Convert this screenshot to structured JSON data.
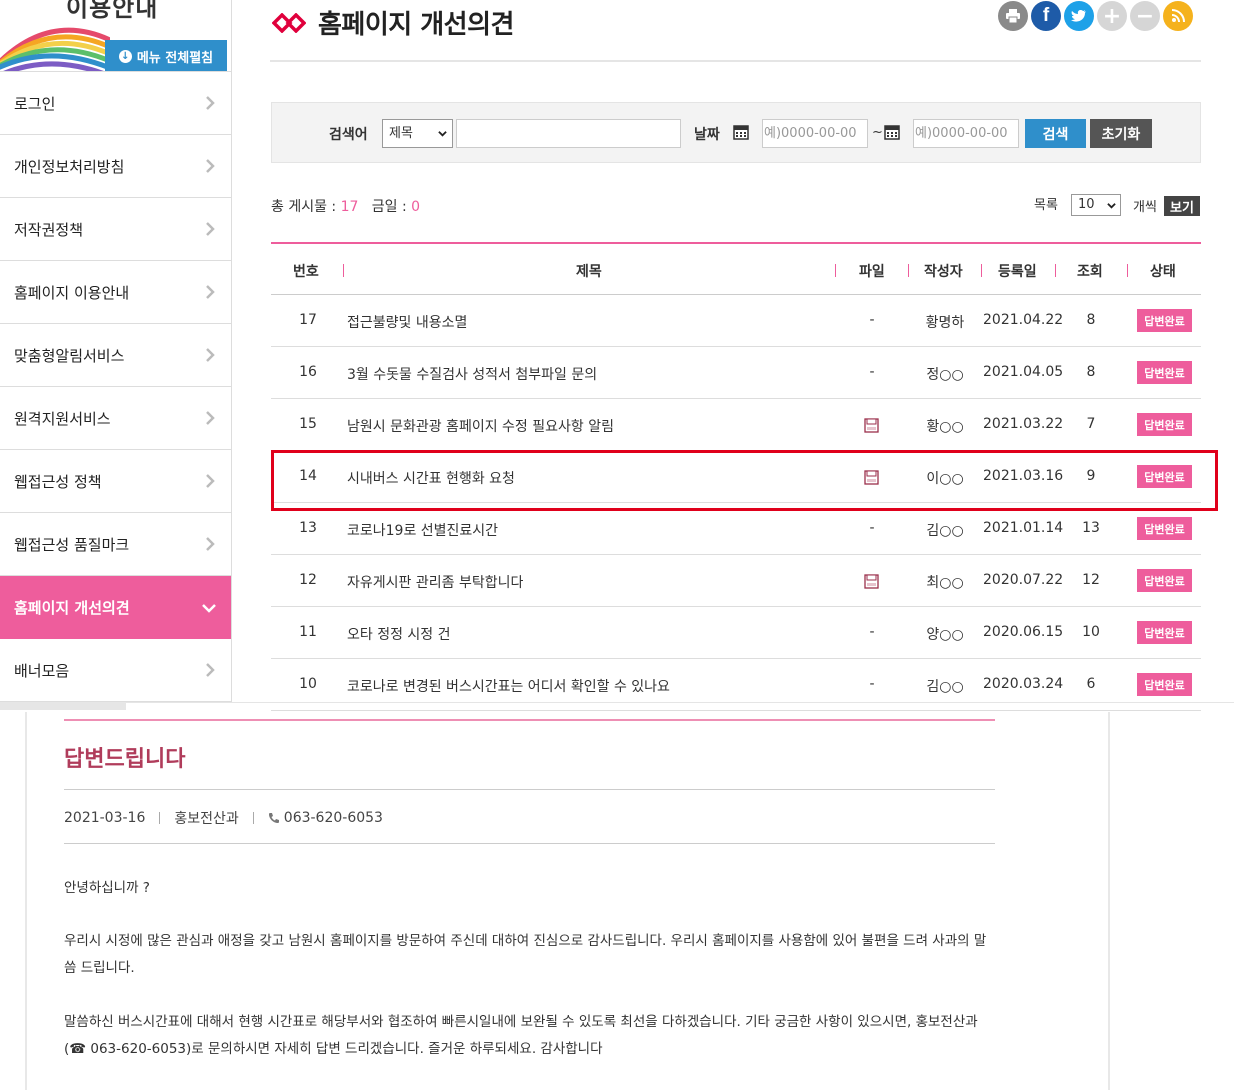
{
  "sidebar": {
    "title": "이용안내",
    "toggle_label": "메뉴 전체펼침",
    "items": [
      {
        "label": "로그인",
        "active": false
      },
      {
        "label": "개인정보처리방침",
        "active": false
      },
      {
        "label": "저작권정책",
        "active": false
      },
      {
        "label": "홈페이지 이용안내",
        "active": false
      },
      {
        "label": "맞춤형알림서비스",
        "active": false
      },
      {
        "label": "원격지원서비스",
        "active": false
      },
      {
        "label": "웹접근성 정책",
        "active": false
      },
      {
        "label": "웹접근성 품질마크",
        "active": false
      },
      {
        "label": "홈페이지 개선의견",
        "active": true
      },
      {
        "label": "배너모음",
        "active": false
      }
    ]
  },
  "header": {
    "title": "홈페이지 개선의견",
    "share_icons": [
      "print-icon",
      "facebook-icon",
      "twitter-icon",
      "zoom-in-icon",
      "zoom-out-icon",
      "rss-icon"
    ]
  },
  "search": {
    "label": "검색어",
    "select_value": "제목",
    "date_label": "날짜",
    "date_from_placeholder": "예)0000-00-00",
    "tilde": "~",
    "date_to_placeholder": "예)0000-00-00",
    "search_button": "검색",
    "reset_button": "초기화"
  },
  "summary": {
    "total_label": "총 게시물 :",
    "total": "17",
    "today_label": "금일 :",
    "today": "0",
    "per_page_label": "목록",
    "per_page_value": "10",
    "per_page_unit": "개씩",
    "view_button": "보기"
  },
  "table": {
    "headers": [
      "번호",
      "제목",
      "파일",
      "작성자",
      "등록일",
      "조회",
      "상태"
    ],
    "rows": [
      {
        "no": "17",
        "title": "접근불량및 내용소멸",
        "file": "-",
        "author": "황명하",
        "date": "2021.04.22",
        "views": "8",
        "status": "답변완료",
        "has_file": false
      },
      {
        "no": "16",
        "title": "3월 수돗물 수질검사 성적서 첨부파일 문의",
        "file": "-",
        "author": "정○○",
        "date": "2021.04.05",
        "views": "8",
        "status": "답변완료",
        "has_file": false
      },
      {
        "no": "15",
        "title": "남원시 문화관광 홈페이지 수정 필요사항 알림",
        "file": "",
        "author": "황○○",
        "date": "2021.03.22",
        "views": "7",
        "status": "답변완료",
        "has_file": true
      },
      {
        "no": "14",
        "title": "시내버스 시간표 현행화 요청",
        "file": "",
        "author": "이○○",
        "date": "2021.03.16",
        "views": "9",
        "status": "답변완료",
        "has_file": true
      },
      {
        "no": "13",
        "title": "코로나19로 선별진료시간",
        "file": "-",
        "author": "김○○",
        "date": "2021.01.14",
        "views": "13",
        "status": "답변완료",
        "has_file": false
      },
      {
        "no": "12",
        "title": "자유게시판 관리좀 부탁합니다",
        "file": "",
        "author": "최○○",
        "date": "2020.07.22",
        "views": "12",
        "status": "답변완료",
        "has_file": true
      },
      {
        "no": "11",
        "title": "오타 정정 시정 건",
        "file": "-",
        "author": "양○○",
        "date": "2020.06.15",
        "views": "10",
        "status": "답변완료",
        "has_file": false
      },
      {
        "no": "10",
        "title": "코로나로 변경된 버스시간표는 어디서 확인할 수 있나요",
        "file": "-",
        "author": "김○○",
        "date": "2020.03.24",
        "views": "6",
        "status": "답변완료",
        "has_file": false
      }
    ]
  },
  "reply": {
    "title": "답변드립니다",
    "date": "2021-03-16",
    "department": "홍보전산과",
    "phone": "063-620-6053",
    "paragraphs": [
      "안녕하십니까 ?",
      "우리시 시정에 많은 관심과 애정을 갖고 남원시 홈페이지를 방문하여 주신데 대하여 진심으로 감사드립니다. 우리시 홈페이지를 사용함에 있어 불편을 드려 사과의 말씀 드립니다.",
      "말씀하신 버스시간표에 대해서 현행 시간표로 해당부서와 협조하여 빠른시일내에 보완될 수 있도록 최선을 다하겠습니다. 기타 궁금한 사항이 있으시면, 홍보전산과(☎ 063-620-6053)로 문의하시면 자세히 답변 드리겠습니다. 즐거운 하루되세요. 감사합니다"
    ]
  },
  "colors": {
    "accent_pink": "#ee5d9c",
    "button_blue": "#2f8fcb",
    "highlight_red": "#e0001b",
    "reply_title": "#b03c5b"
  }
}
